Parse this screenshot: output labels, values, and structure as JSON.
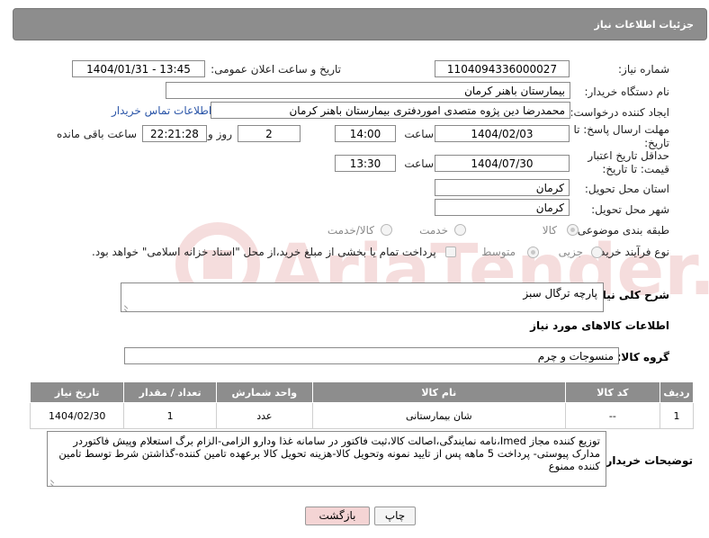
{
  "header": {
    "title": "جزئیات اطلاعات نیاز"
  },
  "form": {
    "need_number_label": "شماره نیاز:",
    "need_number": "1104094336000027",
    "announce_label": "تاریخ و ساعت اعلان عمومی:",
    "announce_value": "1404/01/31 - 13:45",
    "buyer_org_label": "نام دستگاه خریدار:",
    "buyer_org": "بیمارستان باهنر کرمان",
    "creator_label": "ایجاد کننده درخواست:",
    "creator": "محمدرضا  دین پژوه متصدی اموردفتری بیمارستان باهنر کرمان",
    "contact_link": "اطلاعات تماس خریدار",
    "reply_deadline_label": "مهلت ارسال پاسخ: تا تاریخ:",
    "reply_date": "1404/02/03",
    "time_label": "ساعت",
    "reply_time": "14:00",
    "days_value": "2",
    "days_label": "روز و",
    "remaining_value": "22:21:28",
    "remaining_label": "ساعت باقی مانده",
    "price_validity_label": "حداقل تاریخ اعتبار قیمت: تا تاریخ:",
    "price_date": "1404/07/30",
    "price_time": "13:30",
    "province_label": "استان محل تحویل:",
    "province": "کرمان",
    "city_label": "شهر محل تحویل:",
    "city": "کرمان",
    "category_label": "طبقه بندی موضوعی:",
    "category_options": [
      "کالا",
      "خدمت",
      "کالا/خدمت"
    ],
    "process_label": "نوع فرآیند خرید :",
    "process_options": [
      "جزیی",
      "متوسط"
    ],
    "payment_note": "پرداخت تمام یا بخشی از مبلغ خرید،از محل \"اسناد خزانه اسلامی\" خواهد بود."
  },
  "description": {
    "label": "شرح کلی نیاز:",
    "value": "پارچه ترگال سبز"
  },
  "goods_info": {
    "title": "اطلاعات کالاهای مورد نیاز",
    "group_label": "گروه کالا:",
    "group_value": "منسوجات و چرم"
  },
  "table": {
    "headers": [
      "ردیف",
      "کد کالا",
      "نام کالا",
      "واحد شمارش",
      "تعداد / مقدار",
      "تاریخ نیاز"
    ],
    "rows": [
      [
        "1",
        "--",
        "شان بیمارستانی",
        "عدد",
        "1",
        "1404/02/30"
      ]
    ]
  },
  "buyer_notes": {
    "label": "توضیحات خریدار:",
    "value": "توزیع کننده مجاز Imed،نامه نمایندگی،اصالت کالا،ثبت فاکتور در سامانه غذا ودارو الزامی-الزام برگ استعلام وپیش فاکتوردر مدارک پیوستی- پرداخت 5 ماهه پس از تایید نمونه وتحویل کالا-هزینه تحویل کالا برعهده تامین کننده-گذاشتن شرط توسط تامین کننده ممنوع"
  },
  "buttons": {
    "print": "چاپ",
    "back": "بازگشت"
  },
  "watermark": {
    "text": "AriaTender.net"
  },
  "colors": {
    "header_bg": "#8d8d8d",
    "link": "#2a55a8",
    "back_btn_bg": "#f4d4d4",
    "watermark": "#f1c9c9"
  }
}
